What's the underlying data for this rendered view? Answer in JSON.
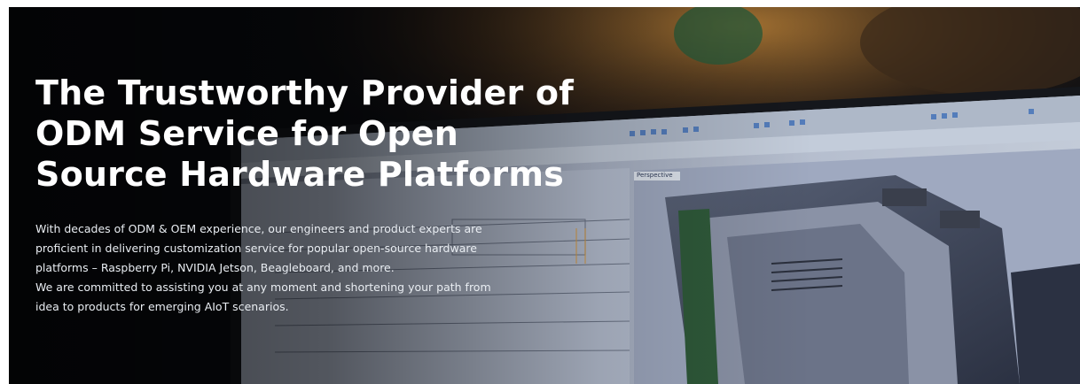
{
  "hero": {
    "title_lines": [
      "The Trustworthy Provider of",
      "ODM Service for Open",
      "Source Hardware Platforms"
    ],
    "description_lines": [
      "With decades of ODM & OEM experience, our engineers and product experts are",
      "proficient in delivering customization service for popular open-source hardware",
      "platforms – Raspberry Pi, NVIDIA Jetson, Beagleboard, and more.",
      "We are committed to assisting you at any moment and shortening your path from",
      "idea to products for emerging AIoT scenarios."
    ],
    "background_image": {
      "label": "Perspective",
      "palette": {
        "dark": "#0b0d12",
        "monitor_bezel": "#15171c",
        "cad_panel": "#c9d2e0",
        "toolbar": "#aeb8c8",
        "viewport": "#9fa9c0",
        "model_metal": "#4a5266",
        "pcb_green": "#2f5a3a",
        "warm_light": "#c88a3a"
      }
    }
  }
}
